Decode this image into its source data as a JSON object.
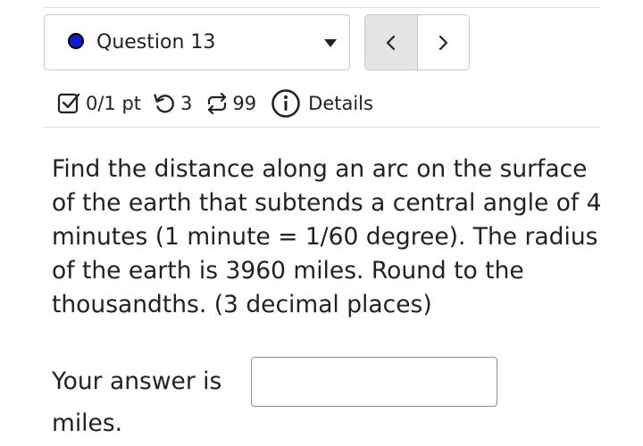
{
  "navigation": {
    "question_label": "Question 13",
    "status_color": "#0b1bd6",
    "prev_icon": "chevron-left-icon",
    "next_icon": "chevron-right-icon"
  },
  "meta": {
    "score": "0/1 pt",
    "retries": "3",
    "attempts": "99",
    "details_label": "Details",
    "icons": [
      "checkbox-icon",
      "retry-icon",
      "repeat-icon",
      "info-icon"
    ]
  },
  "question": {
    "text": "Find the distance along an arc on the surface of the earth that subtends a central angle of 4 minutes (1 minute = 1/60 degree). The radius of the earth is 3960 miles. Round to the thousandths. (3 decimal places)"
  },
  "answer": {
    "label": "Your answer is",
    "value": "",
    "units": "miles."
  }
}
